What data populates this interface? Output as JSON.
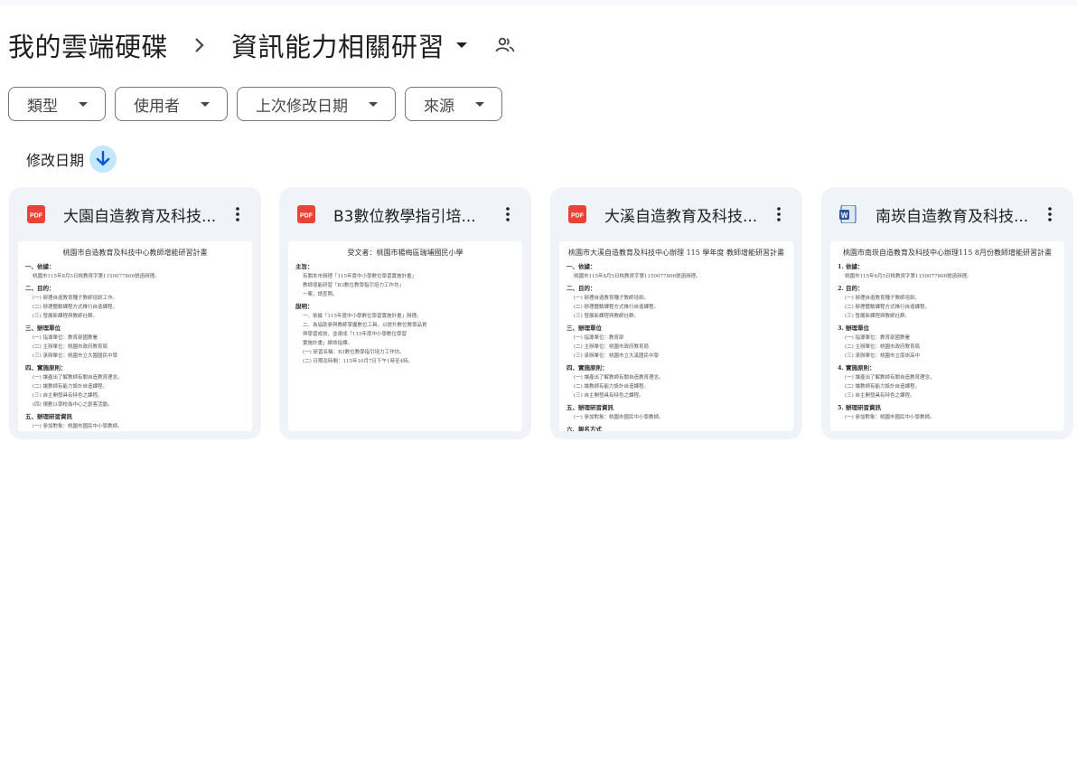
{
  "breadcrumb": {
    "root": "我的雲端硬碟",
    "current": "資訊能力相關研習"
  },
  "filters": [
    {
      "label": "類型"
    },
    {
      "label": "使用者"
    },
    {
      "label": "上次修改日期"
    },
    {
      "label": "來源"
    }
  ],
  "sort": {
    "label": "修改日期",
    "direction_icon": "arrow-down-icon"
  },
  "files": [
    {
      "title": "大園自造教育及科技...",
      "type_icon": "pdf-icon",
      "icon_text": "PDF",
      "preview": {
        "title": "桃園市自造教育及科技中心教師增能研習計畫",
        "sections": [
          {
            "heading": "一、依據：",
            "lines": [
              "桃園市115年8月5日桃教資字第1150077806號函辦理。"
            ]
          },
          {
            "heading": "二、目的：",
            "lines": [
              "(一) 辦理自造教育種子教師培訓工作。",
              "(二) 辦理體驗課程方式推行自造課程。",
              "(三) 發展新課程與教師社群。"
            ]
          },
          {
            "heading": "三、辦理單位",
            "lines": [
              "(一) 指導單位：教育部國教署",
              "(二) 主辦單位：桃園市政府教育局",
              "(三) 承辦單位：桃園市立大園國民中學"
            ]
          },
          {
            "heading": "四、實施原則：",
            "lines": [
              "(一) 讓產出了解教師有關自造教育理念。",
              "(二) 讓教師有能力設計自造課程。",
              "(三) 自主開發具有特色之課程。",
              "(四) 規劃以學校為中心之創客活動。"
            ]
          },
          {
            "heading": "五、辦理研習資訊",
            "lines": [
              "(一) 參加對象：桃園市國民中小學教師。",
              "(二) 課程內容：如附件一。"
            ]
          },
          {
            "heading": "六、報名方式",
            "lines": []
          }
        ]
      }
    },
    {
      "title": "B3數位教學指引培...",
      "type_icon": "pdf-icon",
      "icon_text": "PDF",
      "preview": {
        "title": "受文者：桃園市楊梅區瑞埔國民小學",
        "sections": [
          {
            "heading": "主旨：",
            "lines": [
              "有關本市辦理「115年度中小學數位學習實施計畫」",
              "教師增能研習「B3數位教學指引培力工作坊」",
              "一案，請查照。"
            ]
          },
          {
            "heading": "說明：",
            "lines": [
              "一、依據「115年度中小學數位學習實施計畫」辦理。",
              "二、為協助參與教師掌握數位工具，以提升數位教學品質",
              "與學習成效，並達成「115年度中小學數位學習",
              "實施計畫」績效指標。",
              "(一) 研習名稱：B3數位教學指引培力工作坊。",
              "(二) 日期及時間：115年10月7日下午1時至4時。"
            ]
          }
        ]
      }
    },
    {
      "title": "大溪自造教育及科技...",
      "type_icon": "pdf-icon",
      "icon_text": "PDF",
      "preview": {
        "title": "桃園市大溪自造教育及科技中心辦理 115 學年度 教師增能研習計畫",
        "sections": [
          {
            "heading": "一、依據：",
            "lines": [
              "桃園市115年8月5日桃教資字第1150077806號函辦理。"
            ]
          },
          {
            "heading": "二、目的：",
            "lines": [
              "(一) 辦理自造教育種子教師培訓。",
              "(二) 辦理體驗課程方式推行自造課程。",
              "(三) 發展新課程與教師社群。"
            ]
          },
          {
            "heading": "三、辦理單位",
            "lines": [
              "(一) 指導單位：教育部",
              "(二) 主辦單位：桃園市政府教育局",
              "(三) 承辦單位：桃園市立大溪國民中學"
            ]
          },
          {
            "heading": "四、實施原則：",
            "lines": [
              "(一) 讓產出了解教師有關自造教育理念。",
              "(二) 讓教師有能力設計自造課程。",
              "(三) 自主開發具有特色之課程。"
            ]
          },
          {
            "heading": "五、辦理研習資訊",
            "lines": [
              "(一) 參加對象：桃園市國民中小學教師。"
            ]
          },
          {
            "heading": "六、報名方式",
            "lines": []
          },
          {
            "heading": "七、研習内容",
            "lines": []
          },
          {
            "heading": "八、聯絡人資訊",
            "lines": []
          }
        ]
      }
    },
    {
      "title": "南崁自造教育及科技...",
      "type_icon": "word-icon",
      "icon_text": "W",
      "preview": {
        "title": "桃園市南崁自造教育及科技中心辦理115 8月份教師增能研習計畫",
        "sections": [
          {
            "heading": "1. 依據：",
            "lines": [
              "桃園市115年8月5日桃教資字第1150077806號函辦理。"
            ]
          },
          {
            "heading": "2. 目的：",
            "lines": [
              "(一) 辦理自造教育種子教師培訓。",
              "(二) 辦理體驗課程方式推行自造課程。",
              "(三) 發展新課程與教師社群。"
            ]
          },
          {
            "heading": "3. 辦理單位",
            "lines": [
              "(一) 指導單位：教育部國教署",
              "(二) 主辦單位：桃園市政府教育局",
              "(三) 承辦單位：桃園市立南崁高中"
            ]
          },
          {
            "heading": "4. 實施原則：",
            "lines": [
              "(一) 讓產出了解教師有關自造教育理念。",
              "(二) 讓教師有能力設計自造課程。",
              "(三) 自主開發具有特色之課程。"
            ]
          },
          {
            "heading": "5. 辦理研習資訊",
            "lines": [
              "(一) 參加對象：桃園市國民中小學教師。"
            ]
          }
        ]
      }
    }
  ],
  "colors": {
    "pdf_red": "#ea4335",
    "word_blue": "#2b579a",
    "card_bg": "#f0f4f9",
    "sort_chip_bg": "#c2e7ff",
    "text": "#1f1f1f"
  }
}
